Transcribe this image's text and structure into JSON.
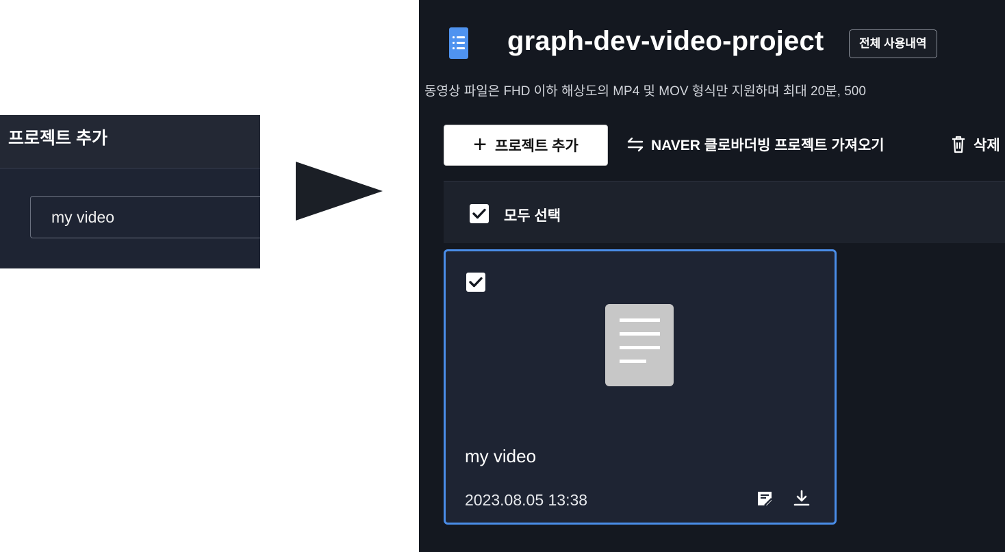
{
  "dialog": {
    "title": "프로젝트 추가",
    "input_value": "my video"
  },
  "project_page": {
    "title": "graph-dev-video-project",
    "usage_history_label": "전체 사용내역",
    "notice": "동영상 파일은 FHD 이하 해상도의 MP4 및 MOV 형식만 지원하며 최대 20분, 500",
    "toolbar": {
      "add_project_label": "프로젝트 추가",
      "import_label": "NAVER 클로바더빙 프로젝트 가져오기",
      "delete_label": "삭제"
    },
    "select_all_label": "모두 선택",
    "select_all_checked": true,
    "projects": [
      {
        "name": "my video",
        "date": "2023.08.05 13:38",
        "checked": true
      }
    ]
  },
  "colors": {
    "page_background": "#141820",
    "card_border": "#4a8de8",
    "doc_icon": "#4f93f0",
    "thumbnail": "#c7c7c7"
  },
  "icons": [
    "document-icon",
    "plus-icon",
    "swap-arrows-icon",
    "trash-icon",
    "checkbox-checked-icon",
    "subtitle-edit-icon",
    "download-icon"
  ]
}
